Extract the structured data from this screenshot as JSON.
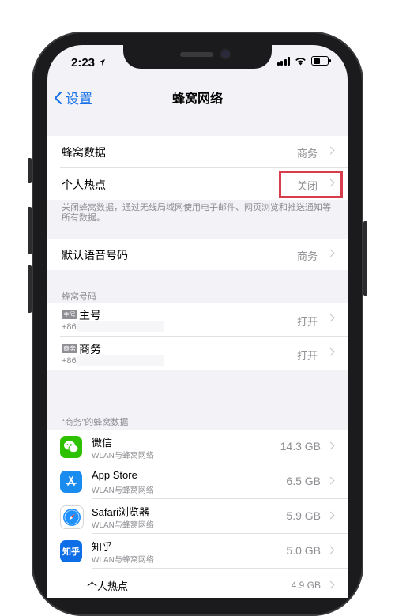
{
  "status": {
    "time": "2:23"
  },
  "nav": {
    "back_label": "设置",
    "title": "蜂窝网络"
  },
  "cellular": {
    "rows": [
      {
        "label": "蜂窝数据",
        "value": "商务"
      },
      {
        "label": "个人热点",
        "value": "关闭"
      }
    ],
    "note": "关闭蜂窝数据，通过无线局域网使用电子邮件、网页浏览和推送通知等所有数据。"
  },
  "voice": {
    "label": "默认语音号码",
    "value": "商务"
  },
  "numbers": {
    "header": "蜂窝号码",
    "items": [
      {
        "badge": "主号",
        "name": "主号",
        "phone": "+86",
        "value": "打开"
      },
      {
        "badge": "商务",
        "name": "商务",
        "phone": "+86",
        "value": "打开"
      }
    ]
  },
  "usage": {
    "header": "“商务”的蜂窝数据",
    "apps": [
      {
        "name": "微信",
        "sub": "WLAN与蜂窝网络",
        "size": "14.3 GB",
        "icon": "wechat-icon",
        "color": "#2dc100"
      },
      {
        "name": "App Store",
        "sub": "WLAN与蜂窝网络",
        "size": "6.5 GB",
        "icon": "app-store-icon",
        "color": "#1a8cf0"
      },
      {
        "name": "Safari浏览器",
        "sub": "WLAN与蜂窝网络",
        "size": "5.9 GB",
        "icon": "safari-icon",
        "color": "#1e90ff"
      },
      {
        "name": "知乎",
        "sub": "WLAN与蜂窝网络",
        "size": "5.0 GB",
        "icon": "zhihu-icon",
        "color": "#0e6ee8"
      }
    ],
    "hotspot": {
      "name": "个人热点",
      "size": "4.9 GB"
    }
  },
  "colors": {
    "accent": "#1a73e8",
    "highlight": "#d83d4b"
  }
}
